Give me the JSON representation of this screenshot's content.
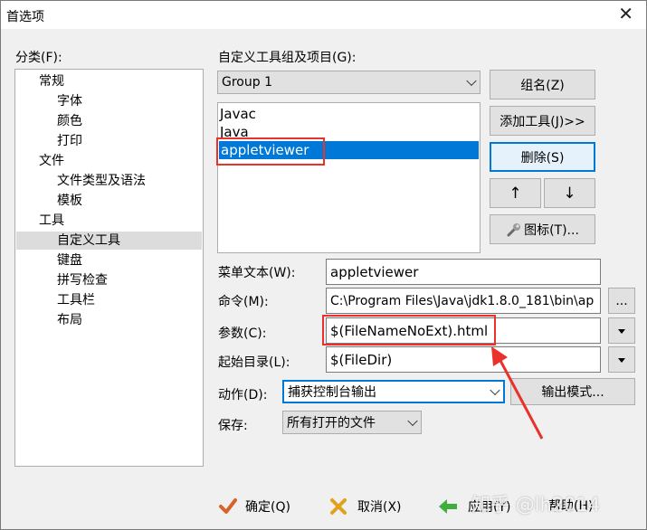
{
  "window": {
    "title": "首选项"
  },
  "category": {
    "label": "分类(F):",
    "items": [
      "常规",
      "字体",
      "颜色",
      "打印",
      "文件",
      "文件类型及语法",
      "模板",
      "工具",
      "自定义工具",
      "键盘",
      "拼写检查",
      "工具栏",
      "布局"
    ]
  },
  "tools": {
    "group_label": "自定义工具组及项目(G):",
    "group_selected": "Group 1",
    "items": [
      "Javac",
      "Java",
      "appletviewer"
    ]
  },
  "buttons": {
    "group_name": "组名(Z)",
    "add_tool": "添加工具(J)>>",
    "delete": "删除(S)",
    "up": "↑",
    "down": "↓",
    "icon": "图标(T)...",
    "ellipsis": "...",
    "output_mode": "输出模式...",
    "ok": "确定(Q)",
    "cancel": "取消(X)",
    "apply": "应用(Y)",
    "help": "帮助(H)"
  },
  "form": {
    "menu_text_label": "菜单文本(W):",
    "menu_text_value": "appletviewer",
    "command_label": "命令(M):",
    "command_value": "C:\\Program Files\\Java\\jdk1.8.0_181\\bin\\ap",
    "params_label": "参数(C):",
    "params_value": "$(FileNameNoExt).html",
    "startdir_label": "起始目录(L):",
    "startdir_value": "$(FileDir)",
    "action_label": "动作(D):",
    "action_value": "捕获控制台输出",
    "save_label": "保存:",
    "save_value": "所有打开的文件"
  },
  "watermark": "知乎 @lh2014",
  "colors": {
    "selection": "#0078d7",
    "annotation": "#e8322b"
  }
}
